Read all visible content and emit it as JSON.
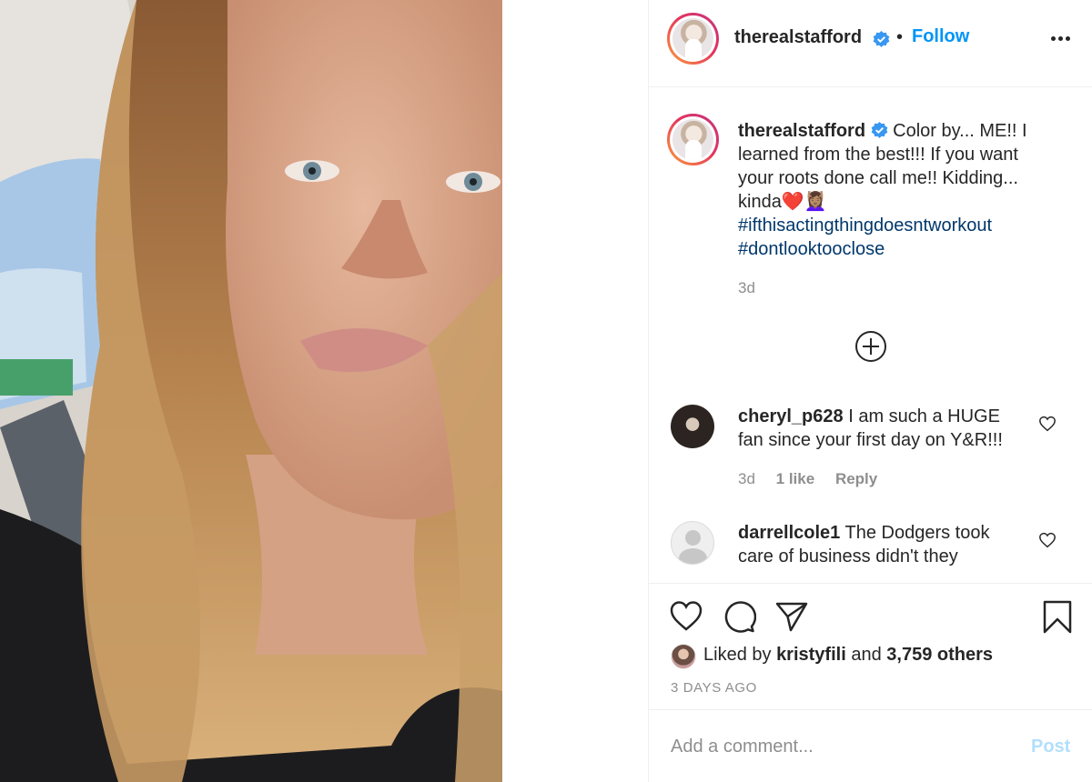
{
  "post": {
    "username": "therealstafford",
    "follow_label": "Follow",
    "separator": "•",
    "caption": {
      "text": "Color by... ME!! I learned from the best!!! If you want your roots done call me!! Kidding... kinda",
      "emoji": "❤️💆🏽‍♀️",
      "hashtags": [
        "#ifthisactingthingdoesntworkout",
        "#dontlooktooclose"
      ],
      "time": "3d"
    },
    "comments": [
      {
        "username": "cheryl_p628",
        "text": "I am such a HUGE fan since your first day on Y&R!!!",
        "time": "3d",
        "likes": "1 like",
        "reply_label": "Reply"
      },
      {
        "username": "darrellcole1",
        "text": "The Dodgers took care of business didn't they"
      }
    ],
    "likes": {
      "prefix": "Liked by",
      "user": "kristyfili",
      "and": "and",
      "others": "3,759 others"
    },
    "timestamp": "3 DAYS AGO",
    "add_comment": {
      "placeholder": "Add a comment...",
      "post_label": "Post"
    }
  },
  "colors": {
    "accent": "#0095f6",
    "hashtag": "#00376b",
    "muted": "#8e8e8e",
    "post_disabled": "#b2dffc"
  }
}
